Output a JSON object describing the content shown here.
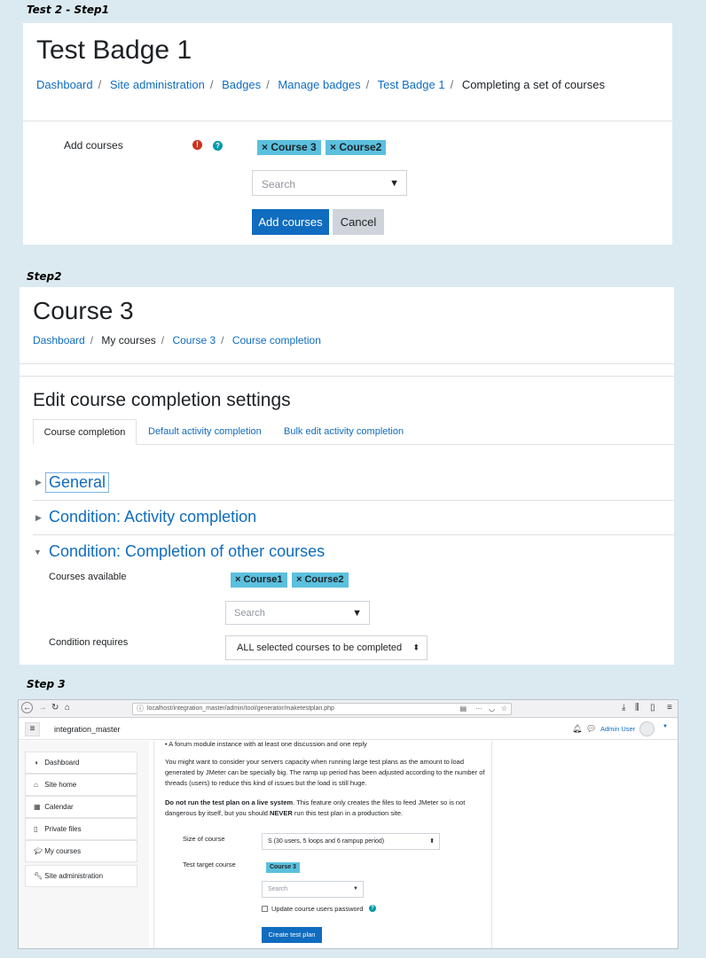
{
  "labels": {
    "step1": "Test 2 - Step1",
    "step2": "Step2",
    "step3": "Step 3"
  },
  "step1": {
    "title": "Test Badge 1",
    "breadcrumb": [
      "Dashboard",
      "Site administration",
      "Badges",
      "Manage badges",
      "Test Badge 1",
      "Completing a set of courses"
    ],
    "field_label": "Add courses",
    "selected": [
      "× Course 3",
      "× Course2"
    ],
    "search_placeholder": "Search",
    "add_button": "Add courses",
    "cancel_button": "Cancel"
  },
  "step2": {
    "title": "Course 3",
    "breadcrumb": [
      "Dashboard",
      "My courses",
      "Course 3",
      "Course completion"
    ],
    "heading": "Edit course completion settings",
    "tabs": [
      "Course completion",
      "Default activity completion",
      "Bulk edit activity completion"
    ],
    "sections": [
      "General",
      "Condition: Activity completion",
      "Condition: Completion of other courses"
    ],
    "courses_available_label": "Courses available",
    "selected": [
      "× Course1",
      "× Course2"
    ],
    "search_placeholder": "Search",
    "condition_label": "Condition requires",
    "condition_value": "ALL selected courses to be completed"
  },
  "step3": {
    "url": "localhost/integration_master/admin/tool/generator/maketestplan.php",
    "site_name": "integration_master",
    "user": "Admin User",
    "sidebar": [
      "Dashboard",
      "Site home",
      "Calendar",
      "Private files",
      "My courses",
      "Site administration"
    ],
    "bullet": "A forum module instance with at least one discussion and one reply",
    "para1": "You might want to consider your servers capacity when running large test plans as the amount to load generated by JMeter can be specially big. The ramp up period has been adjusted according to the number of threads (users) to reduce this kind of issues but the load is still huge.",
    "para2_bold1": "Do not run the test plan on a live system",
    "para2_mid": ". This feature only creates the files to feed JMeter so is not dangerous by itself, but you should ",
    "para2_bold2": "NEVER",
    "para2_end": " run this test plan in a production site.",
    "size_label": "Size of course",
    "size_value": "S (30 users, 5 loops and 6 rampup period)",
    "target_label": "Test target course",
    "target_tag": "Course 3",
    "search_placeholder": "Search",
    "checkbox_label": "Update course users password",
    "create_button": "Create test plan"
  }
}
